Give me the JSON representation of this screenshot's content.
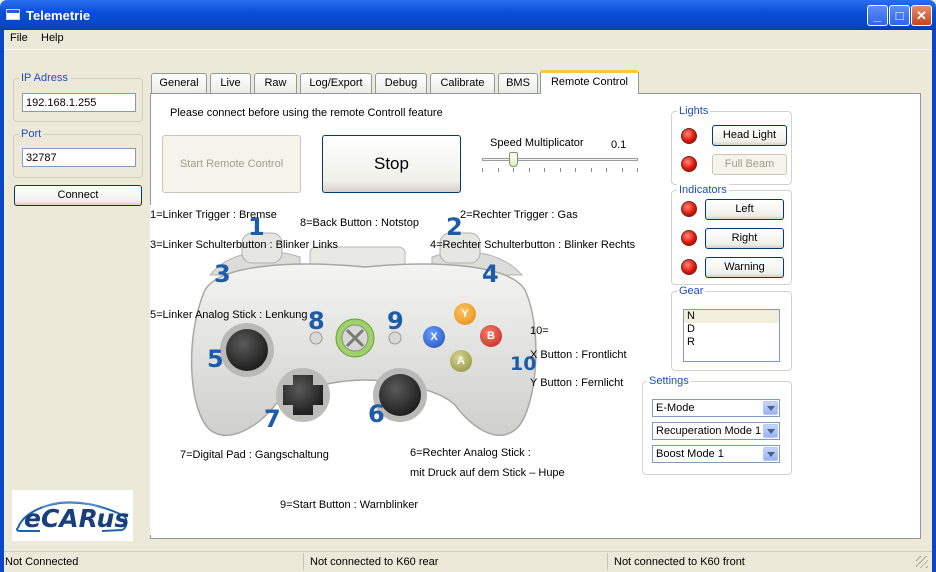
{
  "window": {
    "title": "Telemetrie",
    "minimize": "_",
    "maximize": "□",
    "close": "✕"
  },
  "menu": {
    "file": "File",
    "help": "Help"
  },
  "connection": {
    "ip_label": "IP Adress",
    "ip_value": "192.168.1.255",
    "port_label": "Port",
    "port_value": "32787",
    "connect_label": "Connect"
  },
  "logo": {
    "text": "eCARus"
  },
  "tabs": [
    "General",
    "Live",
    "Raw",
    "Log/Export",
    "Debug",
    "Calibrate",
    "BMS",
    "Remote Control"
  ],
  "active_tab": "Remote Control",
  "remote": {
    "notice": "Please connect before using the remote Controll feature",
    "start_label": "Start Remote Control",
    "stop_label": "Stop",
    "speed_label": "Speed Multiplicator",
    "speed_value": "0.1",
    "speed_slider_fraction": 0.1
  },
  "lights": {
    "title": "Lights",
    "head": "Head Light",
    "full_beam": "Full Beam"
  },
  "indicators": {
    "title": "Indicators",
    "left": "Left",
    "right": "Right",
    "warning": "Warning"
  },
  "gear": {
    "title": "Gear",
    "options": [
      "N",
      "D",
      "R"
    ],
    "selected": "N"
  },
  "settings": {
    "title": "Settings",
    "mode": "E-Mode",
    "recuperation": "Recuperation Mode 1",
    "boost": "Boost Mode 1"
  },
  "controller": {
    "labels": {
      "l1": "1=Linker Trigger : Bremse",
      "l8": "8=Back Button : Notstop",
      "l2": "2=Rechter Trigger : Gas",
      "l3": "3=Linker Schulterbutton : Blinker Links",
      "l4": "4=Rechter Schulterbutton : Blinker Rechts",
      "l5": "5=Linker Analog Stick : Lenkung",
      "l10": "10=",
      "lx": "X Button : Frontlicht",
      "ly": "Y Button : Fernlicht",
      "l7": "7=Digital Pad : Gangschaltung",
      "l6a": "6=Rechter Analog Stick :",
      "l6b": "mit Druck auf dem Stick – Hupe",
      "l9": "9=Start Button : Warnblinker"
    },
    "numbers": {
      "n1": "1",
      "n2": "2",
      "n3": "3",
      "n4": "4",
      "n5": "5",
      "n6": "6",
      "n7": "7",
      "n8": "8",
      "n9": "9",
      "n10": "10"
    },
    "face_buttons": {
      "y": "Y",
      "b": "B",
      "x": "X",
      "a": "A"
    }
  },
  "status": {
    "main": "Not Connected",
    "rear": "Not connected to K60 rear",
    "front": "Not connected to K60 front"
  }
}
